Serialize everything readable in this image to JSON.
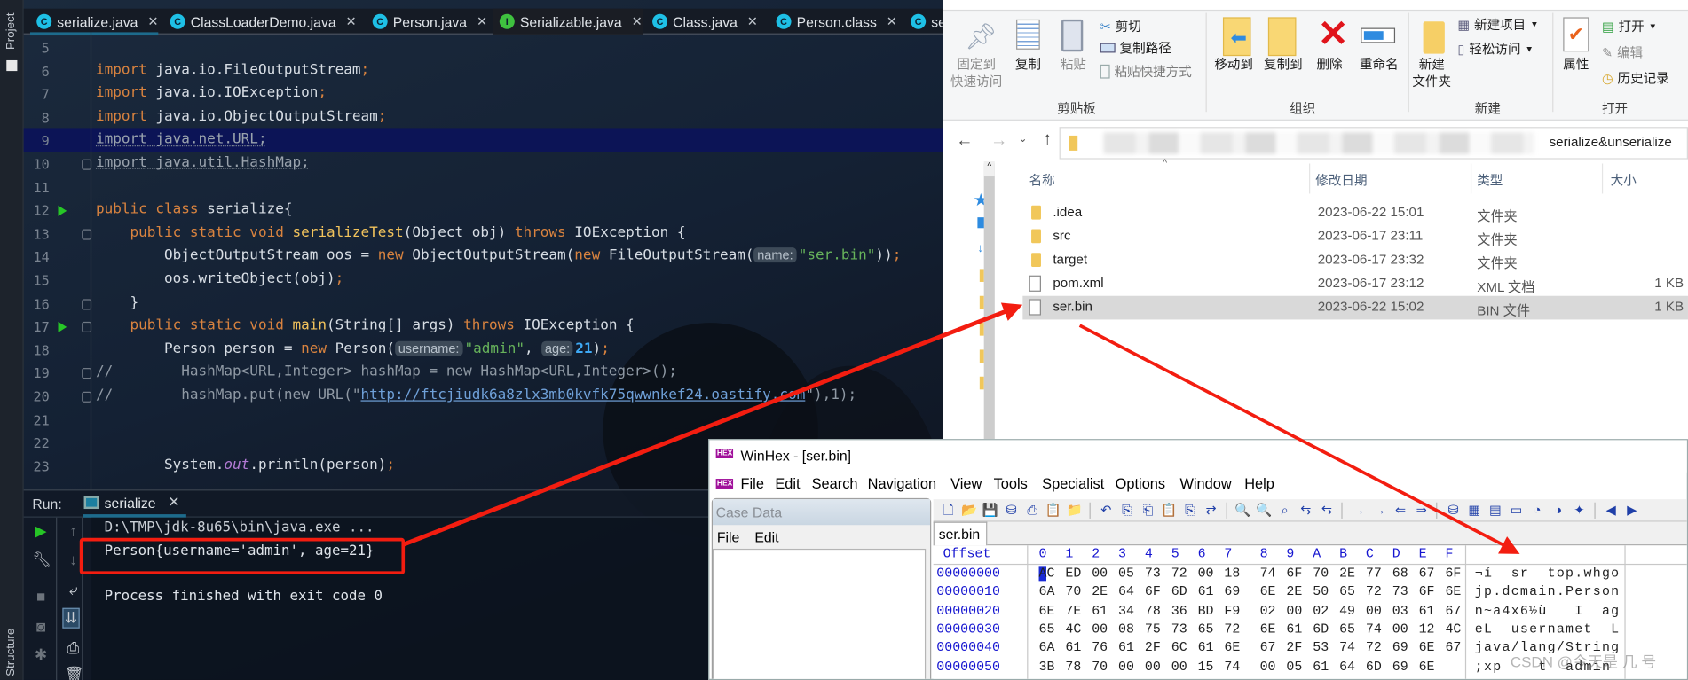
{
  "ide": {
    "sidebar": {
      "project_label": "Project",
      "structure_label": "Structure"
    },
    "tabs": [
      {
        "label": "serialize.java",
        "icon": "class-icon",
        "active": true
      },
      {
        "label": "ClassLoaderDemo.java",
        "icon": "class-icon"
      },
      {
        "label": "Person.java",
        "icon": "class-icon"
      },
      {
        "label": "Serializable.java",
        "icon": "interface-icon"
      },
      {
        "label": "Class.java",
        "icon": "class-icon"
      },
      {
        "label": "Person.class",
        "icon": "class-icon"
      },
      {
        "label": "se",
        "icon": "class-icon"
      }
    ],
    "current_line": 9,
    "lines": [
      {
        "n": "5",
        "tokens": []
      },
      {
        "n": "6",
        "tokens": [
          {
            "t": "import ",
            "c": "kw"
          },
          {
            "t": "java.io.FileOutputStream"
          },
          {
            "t": ";",
            "c": "kw"
          }
        ]
      },
      {
        "n": "7",
        "tokens": [
          {
            "t": "import ",
            "c": "kw"
          },
          {
            "t": "java.io.IOException"
          },
          {
            "t": ";",
            "c": "kw"
          }
        ]
      },
      {
        "n": "8",
        "tokens": [
          {
            "t": "import ",
            "c": "kw"
          },
          {
            "t": "java.io.ObjectOutputStream"
          },
          {
            "t": ";",
            "c": "kw"
          }
        ]
      },
      {
        "n": "9",
        "tokens": [
          {
            "t": "import java.net.URL;",
            "c": "imp"
          }
        ]
      },
      {
        "n": "10",
        "tokens": [
          {
            "t": "import java.util.HashMap;",
            "c": "imp"
          }
        ]
      },
      {
        "n": "11",
        "tokens": []
      },
      {
        "n": "12",
        "run": true,
        "tokens": [
          {
            "t": "public class ",
            "c": "kw"
          },
          {
            "t": "serialize{"
          }
        ]
      },
      {
        "n": "13",
        "tokens": [
          {
            "t": "    public static void ",
            "c": "kw"
          },
          {
            "t": "serializeTest",
            "c": "fn"
          },
          {
            "t": "(Object obj) "
          },
          {
            "t": "throws ",
            "c": "kw"
          },
          {
            "t": "IOException {"
          }
        ]
      },
      {
        "n": "14",
        "tokens": [
          {
            "t": "        ObjectOutputStream oos = "
          },
          {
            "t": "new ",
            "c": "kw"
          },
          {
            "t": "ObjectOutputStream("
          },
          {
            "t": "new ",
            "c": "kw"
          },
          {
            "t": "FileOutputStream("
          },
          {
            "t": "name:",
            "c": "hint"
          },
          {
            "t": "\"ser.bin\"",
            "c": "str"
          },
          {
            "t": "))"
          },
          {
            "t": ";",
            "c": "kw"
          }
        ]
      },
      {
        "n": "15",
        "tokens": [
          {
            "t": "        oos.writeObject(obj)"
          },
          {
            "t": ";",
            "c": "kw"
          }
        ]
      },
      {
        "n": "16",
        "tokens": [
          {
            "t": "    }"
          }
        ]
      },
      {
        "n": "17",
        "run": true,
        "tokens": [
          {
            "t": "    public static void ",
            "c": "kw"
          },
          {
            "t": "main",
            "c": "fn"
          },
          {
            "t": "(String[] args) "
          },
          {
            "t": "throws ",
            "c": "kw"
          },
          {
            "t": "IOException {"
          }
        ]
      },
      {
        "n": "18",
        "tokens": [
          {
            "t": "        Person person = "
          },
          {
            "t": "new ",
            "c": "kw"
          },
          {
            "t": "Person("
          },
          {
            "t": "username:",
            "c": "hint"
          },
          {
            "t": "\"admin\"",
            "c": "str"
          },
          {
            "t": ", "
          },
          {
            "t": "age:",
            "c": "hint"
          },
          {
            "t": "21",
            "c": "num"
          },
          {
            "t": ")"
          },
          {
            "t": ";",
            "c": "kw"
          }
        ]
      },
      {
        "n": "19",
        "tokens": [
          {
            "t": "//        HashMap<URL,Integer> hashMap = new HashMap<URL,Integer>();",
            "c": "cm"
          }
        ]
      },
      {
        "n": "20",
        "tokens": [
          {
            "t": "//        hashMap.put(new URL(\"",
            "c": "cm"
          },
          {
            "t": "http://ftcjiudk6a8zlx3mb0kvfk75qwwnkef24.oastify.com",
            "c": "url"
          },
          {
            "t": "\"),1);",
            "c": "cm"
          }
        ]
      },
      {
        "n": "21",
        "tokens": []
      },
      {
        "n": "22",
        "tokens": []
      },
      {
        "n": "23",
        "tokens": [
          {
            "t": "        System."
          },
          {
            "t": "out",
            "c": "it"
          },
          {
            "t": ".println(person)"
          },
          {
            "t": ";",
            "c": "kw"
          }
        ]
      }
    ],
    "run": {
      "label": "Run:",
      "tab": "serialize",
      "output": [
        "D:\\TMP\\jdk-8u65\\bin\\java.exe ...",
        "Person{username='admin', age=21}",
        "",
        "Process finished with exit code 0"
      ],
      "highlight_color": "#f31d10"
    }
  },
  "explorer": {
    "clipboard": {
      "pin": "固定到\n快速访问",
      "copy": "复制",
      "paste": "粘贴",
      "cut": "剪切",
      "copy_path": "复制路径",
      "paste_shortcut": "粘贴快捷方式",
      "group": "剪贴板"
    },
    "organize": {
      "move_to": "移动到",
      "copy_to": "复制到",
      "delete": "删除",
      "rename": "重命名",
      "group": "组织"
    },
    "new": {
      "new_folder": "新建\n文件夹",
      "new_item": "新建项目",
      "easy_access": "轻松访问",
      "group": "新建"
    },
    "open": {
      "properties": "属性",
      "open": "打开",
      "edit": "编辑",
      "history": "历史记录",
      "group": "打开"
    },
    "address": {
      "path_end": "serialize&unserialize"
    },
    "columns": {
      "name": "名称",
      "date": "修改日期",
      "type": "类型",
      "size": "大小"
    },
    "files": [
      {
        "name": ".idea",
        "date": "2023-06-22 15:01",
        "type": "文件夹",
        "size": "",
        "kind": "folder"
      },
      {
        "name": "src",
        "date": "2023-06-17 23:11",
        "type": "文件夹",
        "size": "",
        "kind": "folder"
      },
      {
        "name": "target",
        "date": "2023-06-17 23:32",
        "type": "文件夹",
        "size": "",
        "kind": "folder"
      },
      {
        "name": "pom.xml",
        "date": "2023-06-17 23:12",
        "type": "XML 文档",
        "size": "1 KB",
        "kind": "file"
      },
      {
        "name": "ser.bin",
        "date": "2023-06-22 15:02",
        "type": "BIN 文件",
        "size": "1 KB",
        "kind": "file",
        "selected": true
      }
    ]
  },
  "winhex": {
    "title": "WinHex - [ser.bin]",
    "menu": [
      "File",
      "Edit",
      "Search",
      "Navigation",
      "View",
      "Tools",
      "Specialist",
      "Options",
      "Window",
      "Help"
    ],
    "case_panel": {
      "title": "Case Data",
      "menu": [
        "File",
        "Edit"
      ]
    },
    "tab": "ser.bin",
    "offset_label": "Offset",
    "columns": [
      "0",
      "1",
      "2",
      "3",
      "4",
      "5",
      "6",
      "7",
      "8",
      "9",
      "A",
      "B",
      "C",
      "D",
      "E",
      "F"
    ],
    "rows": [
      {
        "offset": "00000000",
        "bytes": [
          "AC",
          "ED",
          "00",
          "05",
          "73",
          "72",
          "00",
          "18",
          "74",
          "6F",
          "70",
          "2E",
          "77",
          "68",
          "67",
          "6F"
        ],
        "text": "¬í  sr  top.whgo"
      },
      {
        "offset": "00000010",
        "bytes": [
          "6A",
          "70",
          "2E",
          "64",
          "6F",
          "6D",
          "61",
          "69",
          "6E",
          "2E",
          "50",
          "65",
          "72",
          "73",
          "6F",
          "6E"
        ],
        "text": "jp.dcmain.Person"
      },
      {
        "offset": "00000020",
        "bytes": [
          "6E",
          "7E",
          "61",
          "34",
          "78",
          "36",
          "BD",
          "F9",
          "02",
          "00",
          "02",
          "49",
          "00",
          "03",
          "61",
          "67"
        ],
        "text": "n~a4x6½ù   I  ag"
      },
      {
        "offset": "00000030",
        "bytes": [
          "65",
          "4C",
          "00",
          "08",
          "75",
          "73",
          "65",
          "72",
          "6E",
          "61",
          "6D",
          "65",
          "74",
          "00",
          "12",
          "4C"
        ],
        "text": "eL  usernamet  L"
      },
      {
        "offset": "00000040",
        "bytes": [
          "6A",
          "61",
          "76",
          "61",
          "2F",
          "6C",
          "61",
          "6E",
          "67",
          "2F",
          "53",
          "74",
          "72",
          "69",
          "6E",
          "67"
        ],
        "text": "java/lang/String"
      },
      {
        "offset": "00000050",
        "bytes": [
          "3B",
          "78",
          "70",
          "00",
          "00",
          "00",
          "15",
          "74",
          "00",
          "05",
          "61",
          "64",
          "6D",
          "69",
          "6E"
        ],
        "text": ";xp    t  admin"
      }
    ]
  },
  "watermark": "CSDN @今天是 几 号"
}
